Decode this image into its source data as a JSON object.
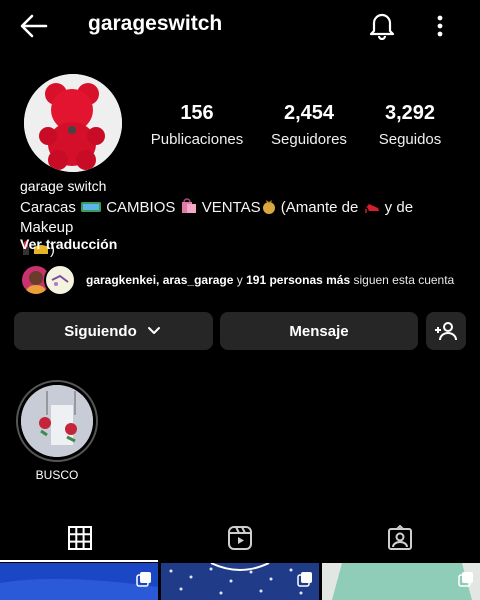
{
  "header": {
    "username": "garageswitch",
    "icons": {
      "back": "arrow-left-icon",
      "notifications": "bell-icon",
      "more": "more-vertical-icon"
    }
  },
  "profile": {
    "stats": [
      {
        "value": "156",
        "label": "Publicaciones"
      },
      {
        "value": "2,454",
        "label": "Seguidores"
      },
      {
        "value": "3,292",
        "label": "Seguidos"
      }
    ],
    "display_name": "garage switch",
    "bio": {
      "part1": "Caracas ",
      "part2": " CAMBIOS ",
      "part3": " VENTAS",
      "part4": " (Amante de ",
      "part5": " y de Makeup",
      "part6": ")"
    },
    "translate_label": "Ver traducción",
    "mutual": {
      "names": "garagkenkei, aras_garage",
      "connector": " y ",
      "more": "191 personas más",
      "suffix": " siguen esta cuenta"
    }
  },
  "actions": {
    "following_label": "Siguiendo",
    "message_label": "Mensaje"
  },
  "highlights": [
    {
      "label": "BUSCO"
    }
  ],
  "tabs": [
    "grid-icon",
    "reels-icon",
    "tagged-icon"
  ],
  "colors": {
    "background": "#000000",
    "button": "#262626",
    "text": "#ffffff"
  }
}
